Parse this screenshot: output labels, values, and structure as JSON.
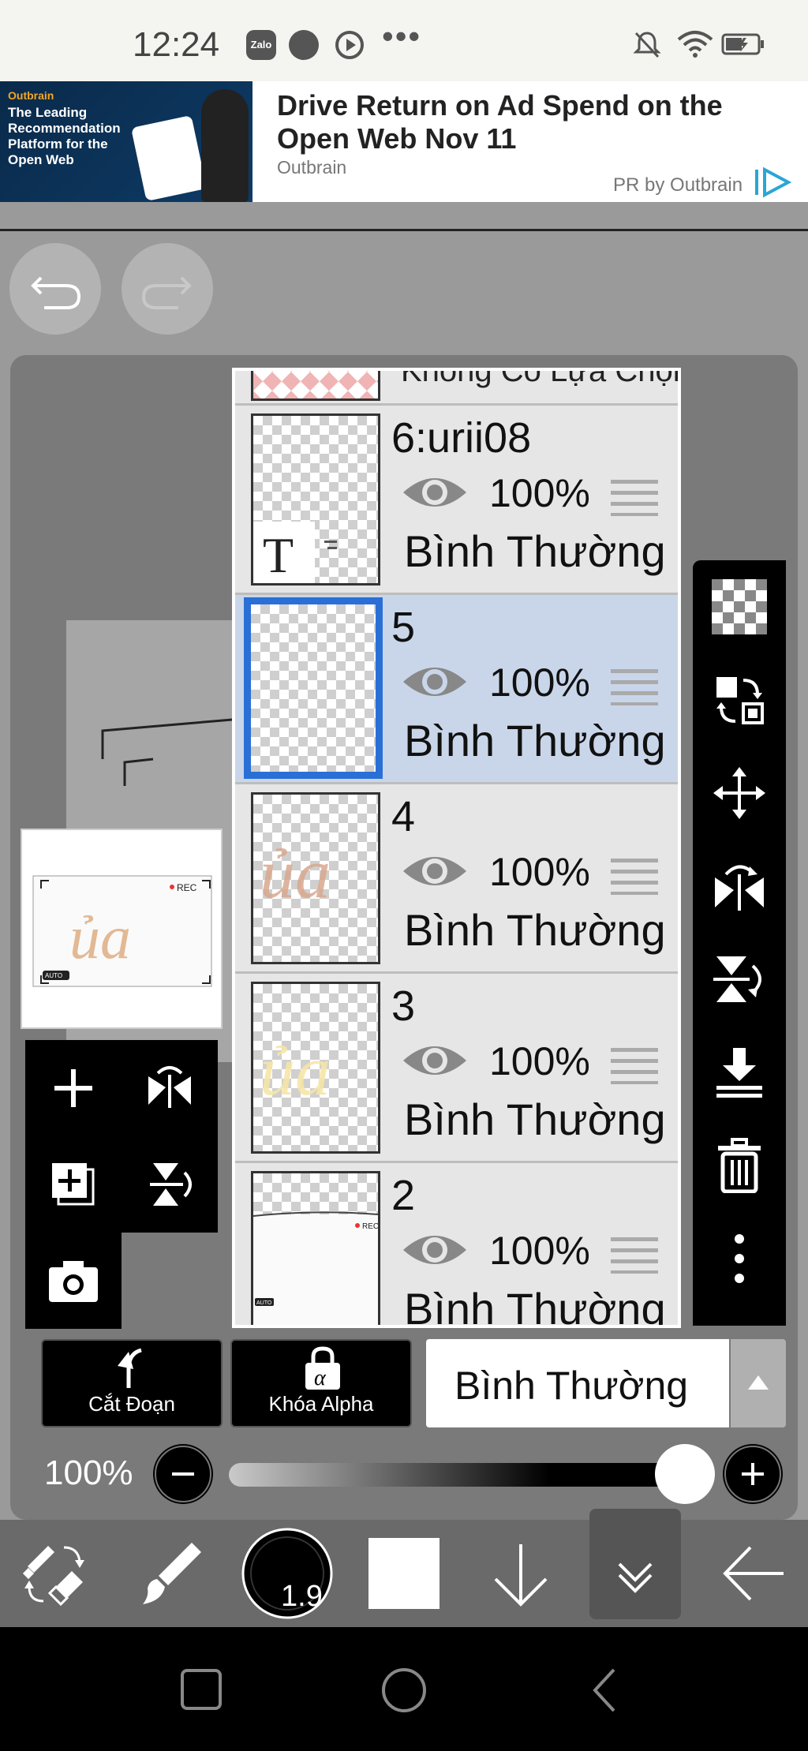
{
  "status_bar": {
    "time": "12:24",
    "notification_apps": [
      "Zalo",
      "chat",
      "play"
    ],
    "more": "•••"
  },
  "ad": {
    "brand": "Outbrain",
    "image_tagline": "The Leading Recommendation Platform for the Open Web",
    "title": "Drive Return on Ad Spend on the Open Web Nov 11",
    "source": "Outbrain",
    "sponsor": "PR by Outbrain"
  },
  "layers": {
    "top_partial_label": "Không Có Lựa Chọn",
    "items": [
      {
        "name": "6:urii08",
        "opacity": "100%",
        "blend": "Bình Thường",
        "selected": false
      },
      {
        "name": "5",
        "opacity": "100%",
        "blend": "Bình Thường",
        "selected": true
      },
      {
        "name": "4",
        "opacity": "100%",
        "blend": "Bình Thường",
        "selected": false
      },
      {
        "name": "3",
        "opacity": "100%",
        "blend": "Bình Thường",
        "selected": false
      },
      {
        "name": "2",
        "opacity": "100%",
        "blend": "Bình Thường",
        "selected": false
      }
    ]
  },
  "thumbnail": {
    "rec_label": "REC",
    "auto_label": "AUTO"
  },
  "layer_thumb_text": {
    "t_icon": "T"
  },
  "bottom_controls": {
    "clip_label": "Cắt Đoạn",
    "alpha_lock_label": "Khóa Alpha",
    "blend_mode": "Bình Thường",
    "opacity_label": "100%"
  },
  "toolbar": {
    "brush_size": "1.9"
  },
  "colors": {
    "selected_layer_bg": "#c9d6ea",
    "selected_layer_border": "#2a6fd6",
    "panel_dark": "#000000"
  }
}
